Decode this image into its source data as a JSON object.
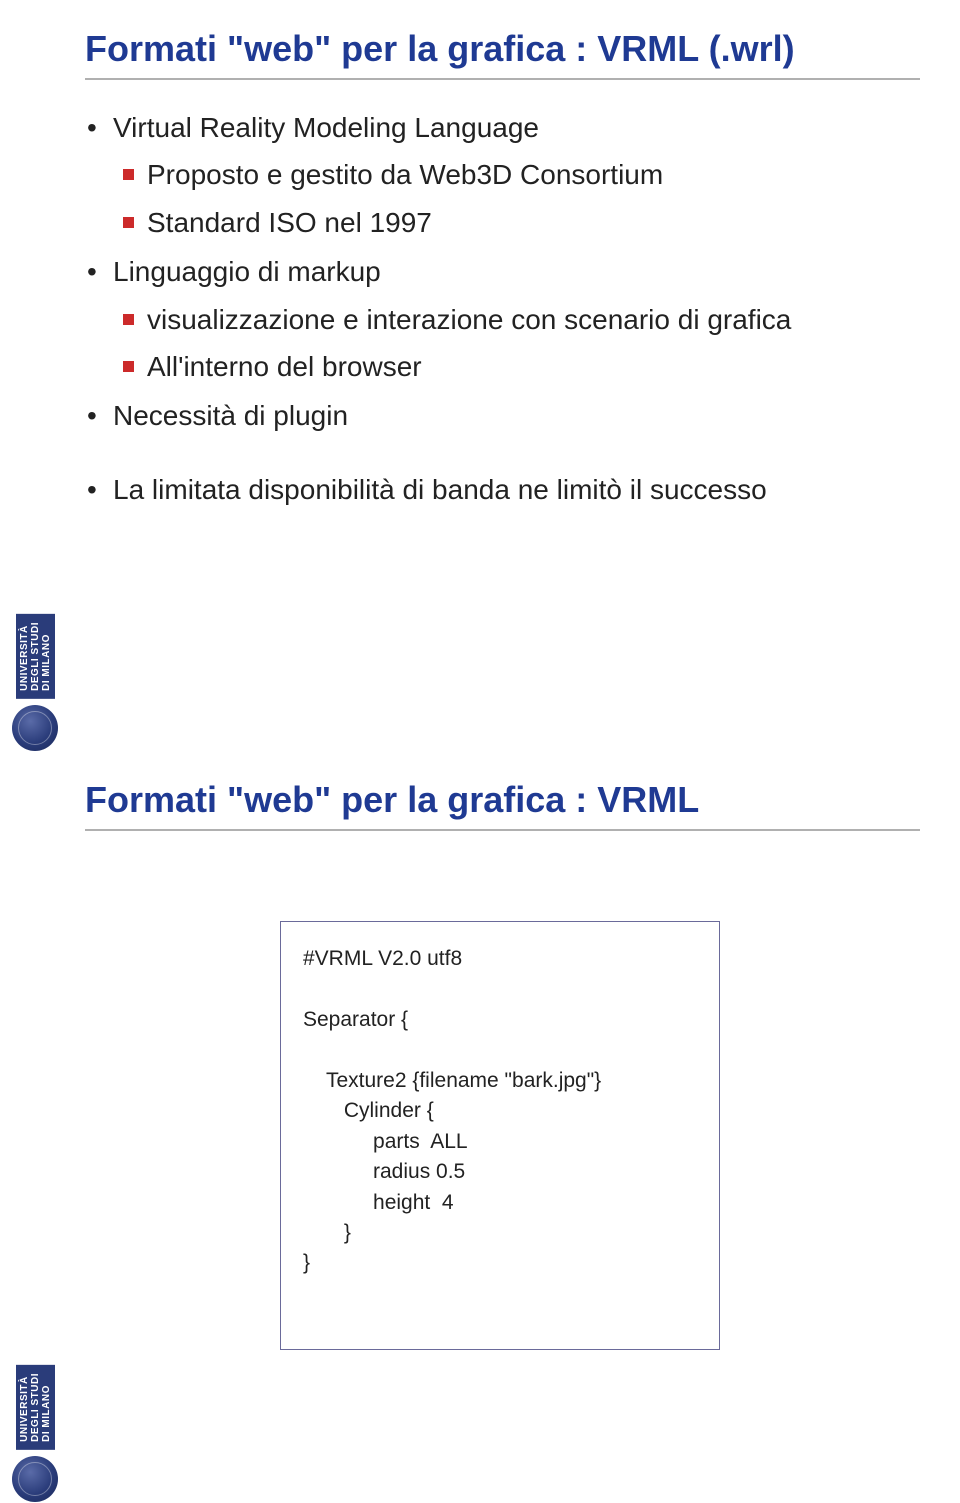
{
  "institution": "UNIVERSITÀ\nDEGLI STUDI\nDI MILANO",
  "slide1": {
    "title": "Formati \"web\" per la grafica : VRML (.wrl)",
    "b1": "Virtual Reality Modeling Language",
    "b1_s1": "Proposto e gestito da Web3D Consortium",
    "b1_s2": "Standard ISO nel 1997",
    "b2": "Linguaggio di markup",
    "b2_s1": "visualizzazione e interazione con scenario di grafica",
    "b2_s2": "All'interno del browser",
    "b3": "Necessità di plugin",
    "b4": "La limitata disponibilità di banda ne limitò il successo"
  },
  "slide2": {
    "title": "Formati \"web\" per la grafica : VRML",
    "code": "#VRML V2.0 utf8\n\nSeparator {\n\n    Texture2 {filename \"bark.jpg\"}\n       Cylinder {\n            parts  ALL\n            radius 0.5\n            height  4\n       }\n}"
  }
}
